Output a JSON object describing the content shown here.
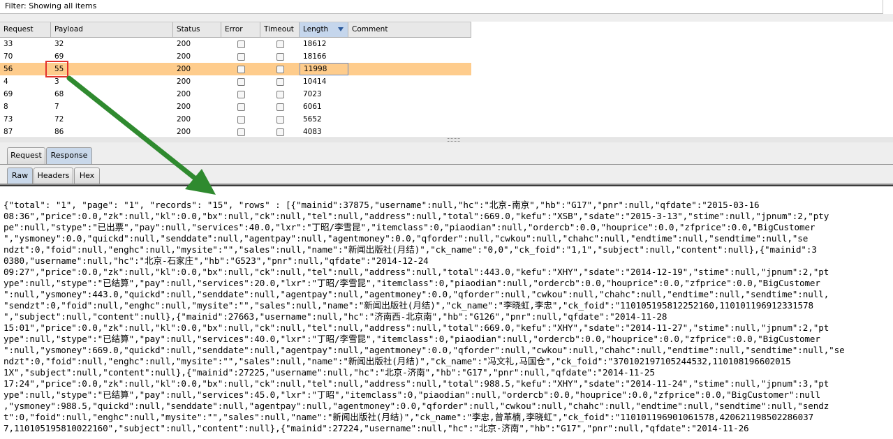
{
  "filter": {
    "text": "Filter: Showing all items"
  },
  "results_table": {
    "headers": [
      "Request",
      "Payload",
      "Status",
      "Error",
      "Timeout",
      "Length",
      "Comment"
    ],
    "sorted_column": "Length",
    "rows": [
      {
        "request": "33",
        "payload": "32",
        "status": "200",
        "length": "18612"
      },
      {
        "request": "70",
        "payload": "69",
        "status": "200",
        "length": "18166"
      },
      {
        "request": "56",
        "payload": "55",
        "status": "200",
        "length": "11998"
      },
      {
        "request": "4",
        "payload": "3",
        "status": "200",
        "length": "10414"
      },
      {
        "request": "69",
        "payload": "68",
        "status": "200",
        "length": "7023"
      },
      {
        "request": "8",
        "payload": "7",
        "status": "200",
        "length": "6061"
      },
      {
        "request": "73",
        "payload": "72",
        "status": "200",
        "length": "5652"
      },
      {
        "request": "87",
        "payload": "86",
        "status": "200",
        "length": "4083"
      }
    ],
    "highlight_color": "#fecc8c"
  },
  "tabs_main": {
    "request": "Request",
    "response": "Response"
  },
  "tabs_view": {
    "raw": "Raw",
    "headers": "Headers",
    "hex": "Hex"
  },
  "response_lines": [
    "{\"total\": \"1\", \"page\": \"1\", \"records\": \"15\", \"rows\" : [{\"mainid\":37875,\"username\":null,\"hc\":\"北京-南京\",\"hb\":\"G17\",\"pnr\":null,\"qfdate\":\"2015-03-16",
    "08:36\",\"price\":0.0,\"zk\":null,\"kl\":0.0,\"bx\":null,\"ck\":null,\"tel\":null,\"address\":null,\"total\":669.0,\"kefu\":\"XSB\",\"sdate\":\"2015-3-13\",\"stime\":null,\"jpnum\":2,\"pty",
    "pe\":null,\"stype\":\"已出票\",\"pay\":null,\"services\":40.0,\"lxr\":\"丁昭/李雪昆\",\"itemclass\":0,\"piaodian\":null,\"ordercb\":0.0,\"houprice\":0.0,\"zfprice\":0.0,\"BigCustomer",
    "\",\"ysmoney\":0.0,\"quickd\":null,\"senddate\":null,\"agentpay\":null,\"agentmoney\":0.0,\"qforder\":null,\"cwkou\":null,\"chahc\":null,\"endtime\":null,\"sendtime\":null,\"se",
    "ndzt\":0,\"foid\":null,\"enghc\":null,\"mysite\":\"\",\"sales\":null,\"name\":\"新闻出版社(月结)\",\"ck_name\":\"0,0\",\"ck_foid\":\"1,1\",\"subject\":null,\"content\":null},{\"mainid\":3",
    "0380,\"username\":null,\"hc\":\"北京-石家庄\",\"hb\":\"G523\",\"pnr\":null,\"qfdate\":\"2014-12-24",
    "09:27\",\"price\":0.0,\"zk\":null,\"kl\":0.0,\"bx\":null,\"ck\":null,\"tel\":null,\"address\":null,\"total\":443.0,\"kefu\":\"XHY\",\"sdate\":\"2014-12-19\",\"stime\":null,\"jpnum\":2,\"pt",
    "ype\":null,\"stype\":\"已结算\",\"pay\":null,\"services\":20.0,\"lxr\":\"丁昭/李雪昆\",\"itemclass\":0,\"piaodian\":null,\"ordercb\":0.0,\"houprice\":0.0,\"zfprice\":0.0,\"BigCustomer",
    "\":null,\"ysmoney\":443.0,\"quickd\":null,\"senddate\":null,\"agentpay\":null,\"agentmoney\":0.0,\"qforder\":null,\"cwkou\":null,\"chahc\":null,\"endtime\":null,\"sendtime\":null,",
    "\"sendzt\":0,\"foid\":null,\"enghc\":null,\"mysite\":\"\",\"sales\":null,\"name\":\"新闻出版社(月结)\",\"ck_name\":\"李晓虹,李忠\",\"ck_foid\":\"110105195812252160,110101196912331578",
    "\",\"subject\":null,\"content\":null},{\"mainid\":27663,\"username\":null,\"hc\":\"济南西-北京南\",\"hb\":\"G126\",\"pnr\":null,\"qfdate\":\"2014-11-28",
    "15:01\",\"price\":0.0,\"zk\":null,\"kl\":0.0,\"bx\":null,\"ck\":null,\"tel\":null,\"address\":null,\"total\":669.0,\"kefu\":\"XHY\",\"sdate\":\"2014-11-27\",\"stime\":null,\"jpnum\":2,\"pt",
    "ype\":null,\"stype\":\"已结算\",\"pay\":null,\"services\":40.0,\"lxr\":\"丁昭/李雪昆\",\"itemclass\":0,\"piaodian\":null,\"ordercb\":0.0,\"houprice\":0.0,\"zfprice\":0.0,\"BigCustomer",
    "\":null,\"ysmoney\":669.0,\"quickd\":null,\"senddate\":null,\"agentpay\":null,\"agentmoney\":0.0,\"qforder\":null,\"cwkou\":null,\"chahc\":null,\"endtime\":null,\"sendtime\":null,\"se",
    "ndzt\":0,\"foid\":null,\"enghc\":null,\"mysite\":\"\",\"sales\":null,\"name\":\"新闻出版社(月结)\",\"ck_name\":\"冯文礼,马国仓\",\"ck_foid\":\"370102197105244532,110108196602015",
    "1X\",\"subject\":null,\"content\":null},{\"mainid\":27225,\"username\":null,\"hc\":\"北京-济南\",\"hb\":\"G17\",\"pnr\":null,\"qfdate\":\"2014-11-25",
    "17:24\",\"price\":0.0,\"zk\":null,\"kl\":0.0,\"bx\":null,\"ck\":null,\"tel\":null,\"address\":null,\"total\":988.5,\"kefu\":\"XHY\",\"sdate\":\"2014-11-24\",\"stime\":null,\"jpnum\":3,\"pt",
    "ype\":null,\"stype\":\"已结算\",\"pay\":null,\"services\":45.0,\"lxr\":\"丁昭\",\"itemclass\":0,\"piaodian\":null,\"ordercb\":0.0,\"houprice\":0.0,\"zfprice\":0.0,\"BigCustomer\":null",
    ",\"ysmoney\":988.5,\"quickd\":null,\"senddate\":null,\"agentpay\":null,\"agentmoney\":0.0,\"qforder\":null,\"cwkou\":null,\"chahc\":null,\"endtime\":null,\"sendtime\":null,\"sendz",
    "t\":0,\"foid\":null,\"enghc\":null,\"mysite\":\"\",\"sales\":null,\"name\":\"新闻出版社(月结)\",\"ck_name\":\"李忠,曾革楠,李晓虹\",\"ck_foid\":\"110101196901061578,420621198502286037",
    "7,110105195810022160\",\"subject\":null,\"content\":null},{\"mainid\":27224,\"username\":null,\"hc\":\"北京-济南\",\"hb\":\"G17\",\"pnr\":null,\"qfdate\":\"2014-11-26"
  ],
  "annotation": {
    "box_color": "#e2322c",
    "arrow_color": "#2f8a2f"
  }
}
